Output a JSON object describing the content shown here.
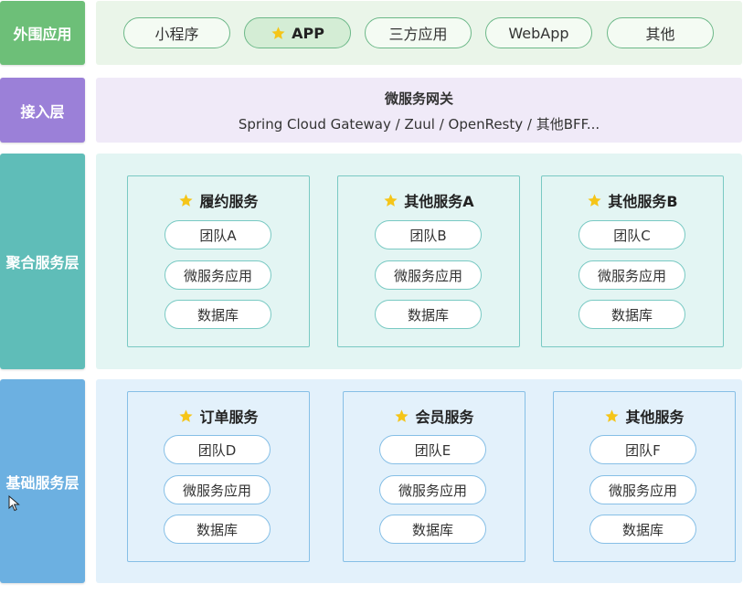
{
  "colors": {
    "outer_label": "#6dbf78",
    "access_label": "#9b80d8",
    "aggregate_label": "#5fbdb8",
    "base_label": "#6cb0e1",
    "star": "#f5c518"
  },
  "layers": {
    "outer": {
      "label": "外围应用",
      "apps": [
        "小程序",
        "APP",
        "三方应用",
        "WebApp",
        "其他"
      ],
      "active_app": "APP",
      "active_icon": "star-icon"
    },
    "access": {
      "label": "接入层",
      "title": "微服务网关",
      "subtitle": "Spring Cloud Gateway /  Zuul / OpenResty / 其他BFF..."
    },
    "aggregate": {
      "label": "聚合服务层",
      "services": [
        {
          "title": "履约服务",
          "items": [
            "团队A",
            "微服务应用",
            "数据库"
          ]
        },
        {
          "title": "其他服务A",
          "items": [
            "团队B",
            "微服务应用",
            "数据库"
          ]
        },
        {
          "title": "其他服务B",
          "items": [
            "团队C",
            "微服务应用",
            "数据库"
          ]
        }
      ]
    },
    "base": {
      "label": "基础服务层",
      "services": [
        {
          "title": "订单服务",
          "items": [
            "团队D",
            "微服务应用",
            "数据库"
          ]
        },
        {
          "title": "会员服务",
          "items": [
            "团队E",
            "微服务应用",
            "数据库"
          ]
        },
        {
          "title": "其他服务",
          "items": [
            "团队F",
            "微服务应用",
            "数据库"
          ]
        }
      ]
    }
  }
}
